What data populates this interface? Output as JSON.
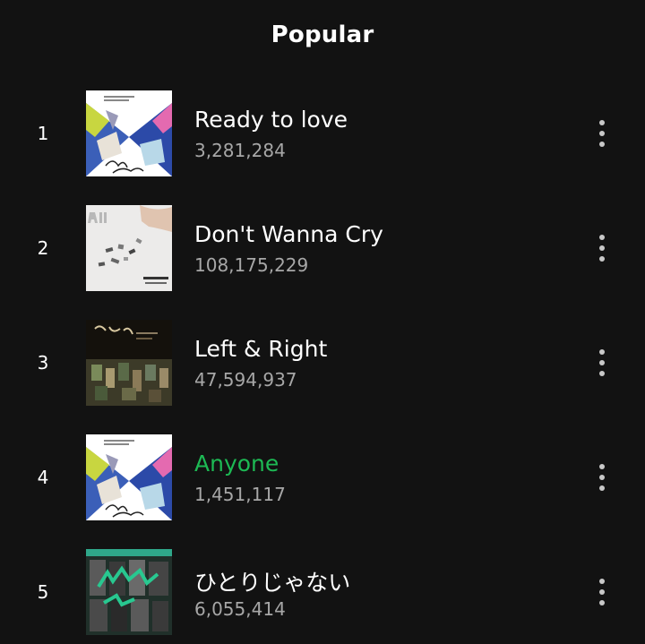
{
  "section_title": "Popular",
  "tracks": [
    {
      "rank": "1",
      "title": "Ready to love",
      "plays": "3,281,284",
      "cover": "your-choice",
      "active": false
    },
    {
      "rank": "2",
      "title": "Don't Wanna Cry",
      "plays": "108,175,229",
      "cover": "al1",
      "active": false
    },
    {
      "rank": "3",
      "title": "Left & Right",
      "plays": "47,594,937",
      "cover": "heng-garae",
      "active": false
    },
    {
      "rank": "4",
      "title": "Anyone",
      "plays": "1,451,117",
      "cover": "your-choice",
      "active": true
    },
    {
      "rank": "5",
      "title": "ひとりじゃない",
      "plays": "6,055,414",
      "cover": "hitorijanai",
      "active": false
    }
  ],
  "colors": {
    "background": "#121212",
    "text": "#ffffff",
    "secondary_text": "#a7a7a7",
    "active": "#1db954"
  },
  "icons": {
    "more": "vertical-ellipsis-icon"
  }
}
